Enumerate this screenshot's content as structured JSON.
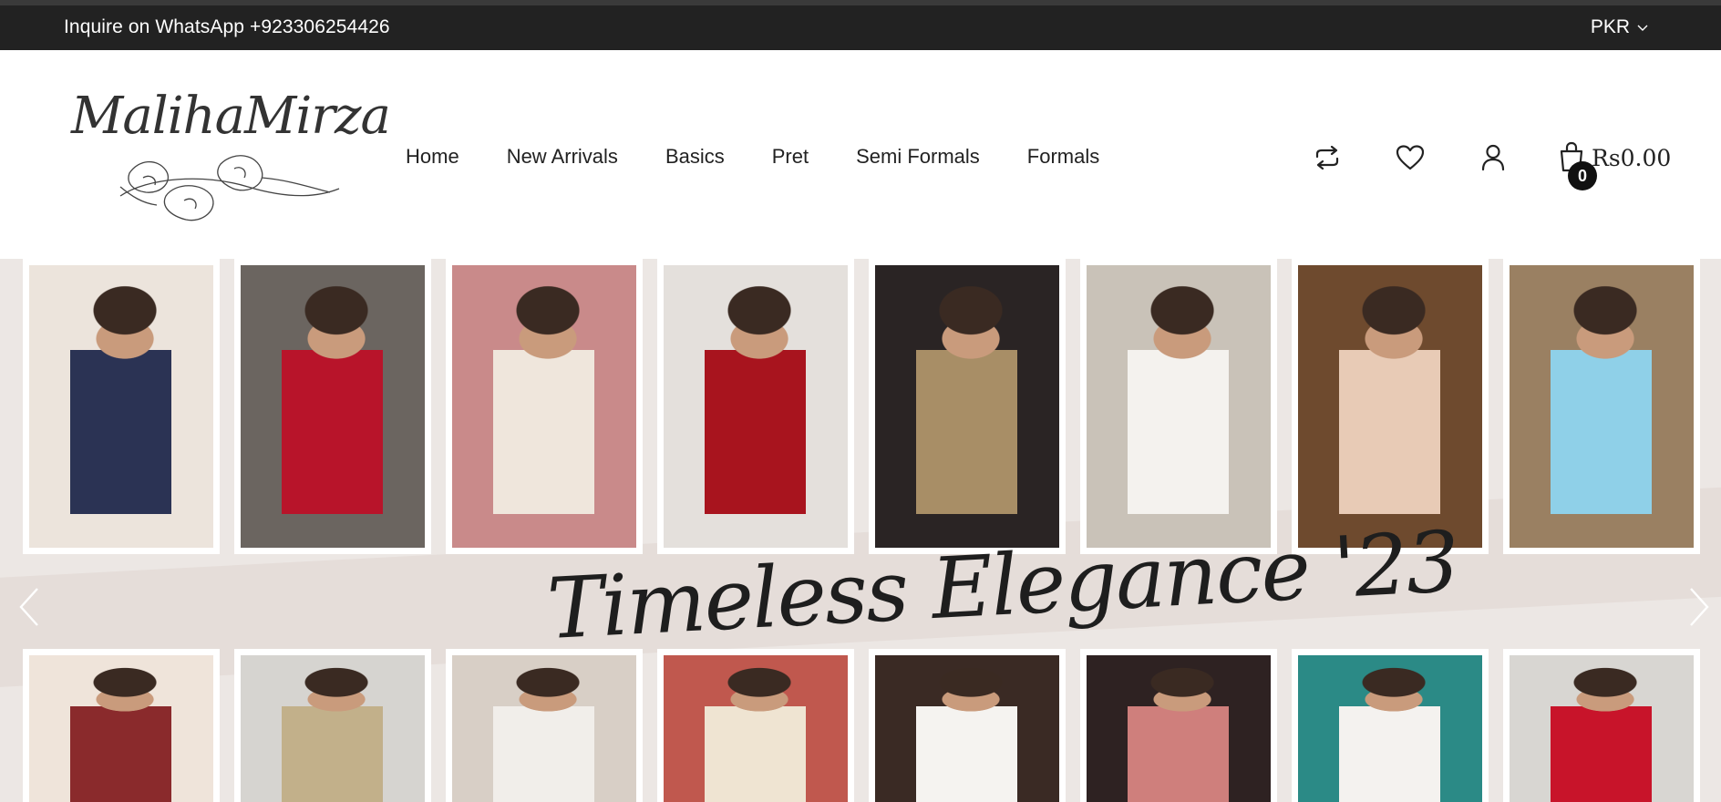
{
  "announcement": {
    "whatsapp_text": "Inquire on WhatsApp +923306254426",
    "currency": "PKR"
  },
  "brand": {
    "logo_text": "MalihaMirza"
  },
  "nav": {
    "items": [
      {
        "label": "Home"
      },
      {
        "label": "New Arrivals"
      },
      {
        "label": "Basics"
      },
      {
        "label": "Pret"
      },
      {
        "label": "Semi Formals"
      },
      {
        "label": "Formals"
      }
    ]
  },
  "header_icons": [
    "compare-icon",
    "wishlist-heart-icon",
    "account-user-icon",
    "cart-bag-icon"
  ],
  "cart": {
    "count": "0",
    "total": "Rs0.00"
  },
  "banner": {
    "headline": "Timeless Elegance '23",
    "photos_top": [
      {
        "bg": "#2b3354",
        "accent": "#ece4dc"
      },
      {
        "bg": "#b8142a",
        "accent": "#6b6560"
      },
      {
        "bg": "#efe6dc",
        "accent": "#c98a8a"
      },
      {
        "bg": "#a8141e",
        "accent": "#e4e0dc"
      },
      {
        "bg": "#a88e66",
        "accent": "#2a2424"
      },
      {
        "bg": "#f4f2ee",
        "accent": "#c9c2b8"
      },
      {
        "bg": "#e8cbb6",
        "accent": "#6e4a2e"
      },
      {
        "bg": "#8fd0e8",
        "accent": "#9a8062"
      }
    ],
    "photos_bottom": [
      {
        "bg": "#8a2a2c",
        "accent": "#efe4da"
      },
      {
        "bg": "#c2b08a",
        "accent": "#d6d4d0"
      },
      {
        "bg": "#f1eeea",
        "accent": "#d8cfc6"
      },
      {
        "bg": "#efe4d2",
        "accent": "#c0584e"
      },
      {
        "bg": "#f5f3f0",
        "accent": "#3a2a24"
      },
      {
        "bg": "#cf7f7c",
        "accent": "#2e2222"
      },
      {
        "bg": "#f4f2ef",
        "accent": "#2b8a86"
      },
      {
        "bg": "#c8142a",
        "accent": "#d8d6d2"
      }
    ]
  },
  "colors": {
    "announcement_bg": "#222222",
    "banner_bg": "#ece7e4",
    "text_dark": "#222222"
  }
}
